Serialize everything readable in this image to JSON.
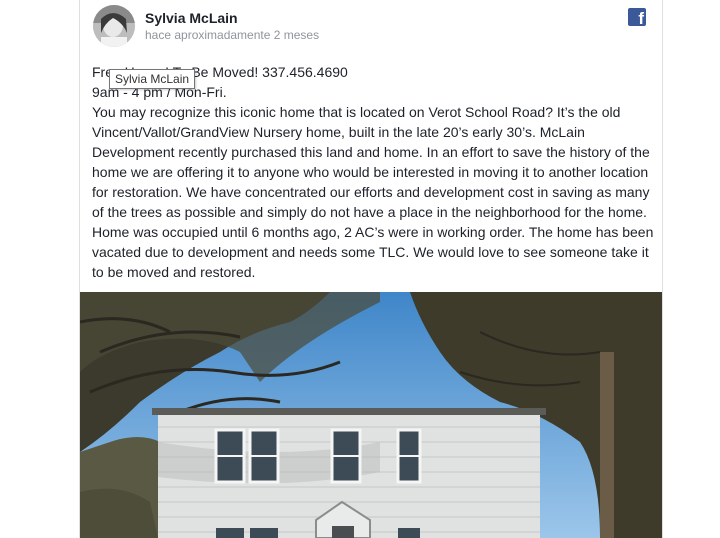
{
  "post": {
    "author": "Sylvia McLain",
    "timestamp": "hace aproximadamente 2 meses",
    "headline": "Free House! To Be Moved! 337.456.4690",
    "hours": "9am - 4 pm / Mon-Fri.",
    "body": "You may recognize this iconic home that is located on Verot School Road? It’s the old Vincent/Vallot/GrandView Nursery home, built in the late 20’s early 30’s. McLain Development recently purchased this land and home. In an effort to save the history of the home we are offering it to anyone who would be interested in moving it to another location for restoration. We have concentrated our efforts and development cost in saving as many of the trees as possible and simply do not have a place in the neighborhood for the home. Home was occupied until 6 months ago, 2 AC’s were in working order. The home has been vacated due to development and needs some TLC. We would love to see someone take it to be moved and restored."
  },
  "tooltip": {
    "text": "Sylvia McLain"
  },
  "brand": {
    "logo_glyph": "f",
    "icon": "facebook-icon",
    "color": "#3b5998"
  },
  "photo": {
    "subject": "house-photo"
  }
}
